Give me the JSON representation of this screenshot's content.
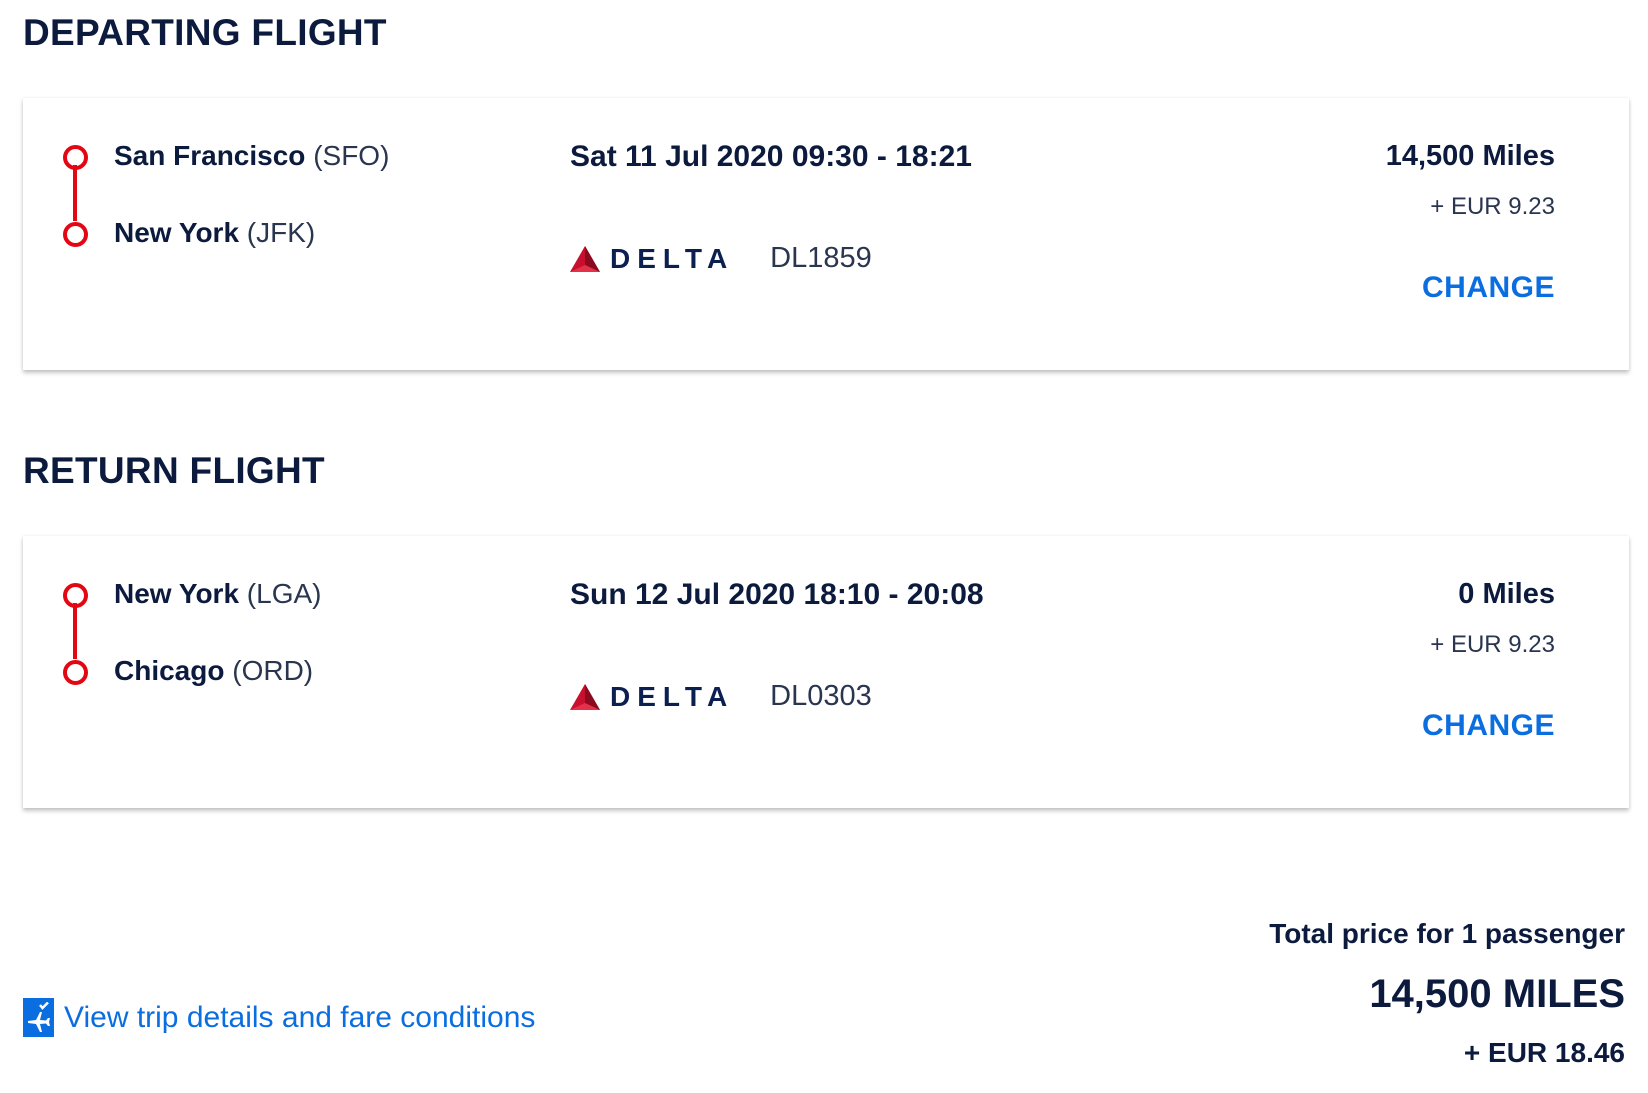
{
  "flights": [
    {
      "section_title": "DEPARTING FLIGHT",
      "origin": {
        "city": "San Francisco",
        "code": "(SFO)"
      },
      "destination": {
        "city": "New York",
        "code": "(JFK)"
      },
      "datetime": "Sat 11 Jul 2020  09:30 - 18:21",
      "airline": "DELTA",
      "flight_number": "DL1859",
      "miles": "14,500 Miles",
      "fee": "+ EUR 9.23",
      "change_label": "CHANGE"
    },
    {
      "section_title": "RETURN FLIGHT",
      "origin": {
        "city": "New York",
        "code": "(LGA)"
      },
      "destination": {
        "city": "Chicago",
        "code": "(ORD)"
      },
      "datetime": "Sun 12 Jul 2020  18:10 - 20:08",
      "airline": "DELTA",
      "flight_number": "DL0303",
      "miles": "0 Miles",
      "fee": "+ EUR 9.23",
      "change_label": "CHANGE"
    }
  ],
  "trip_link": {
    "label": "View trip details and fare conditions",
    "icon": "plane-checklist-icon"
  },
  "total": {
    "label": "Total price for 1 passenger",
    "miles": "14,500 MILES",
    "fee": "+ EUR 18.46"
  },
  "colors": {
    "route_red": "#e30613",
    "link_blue": "#0a6ee0",
    "text_navy": "#0b1a3d",
    "delta_red": "#c8102e"
  }
}
